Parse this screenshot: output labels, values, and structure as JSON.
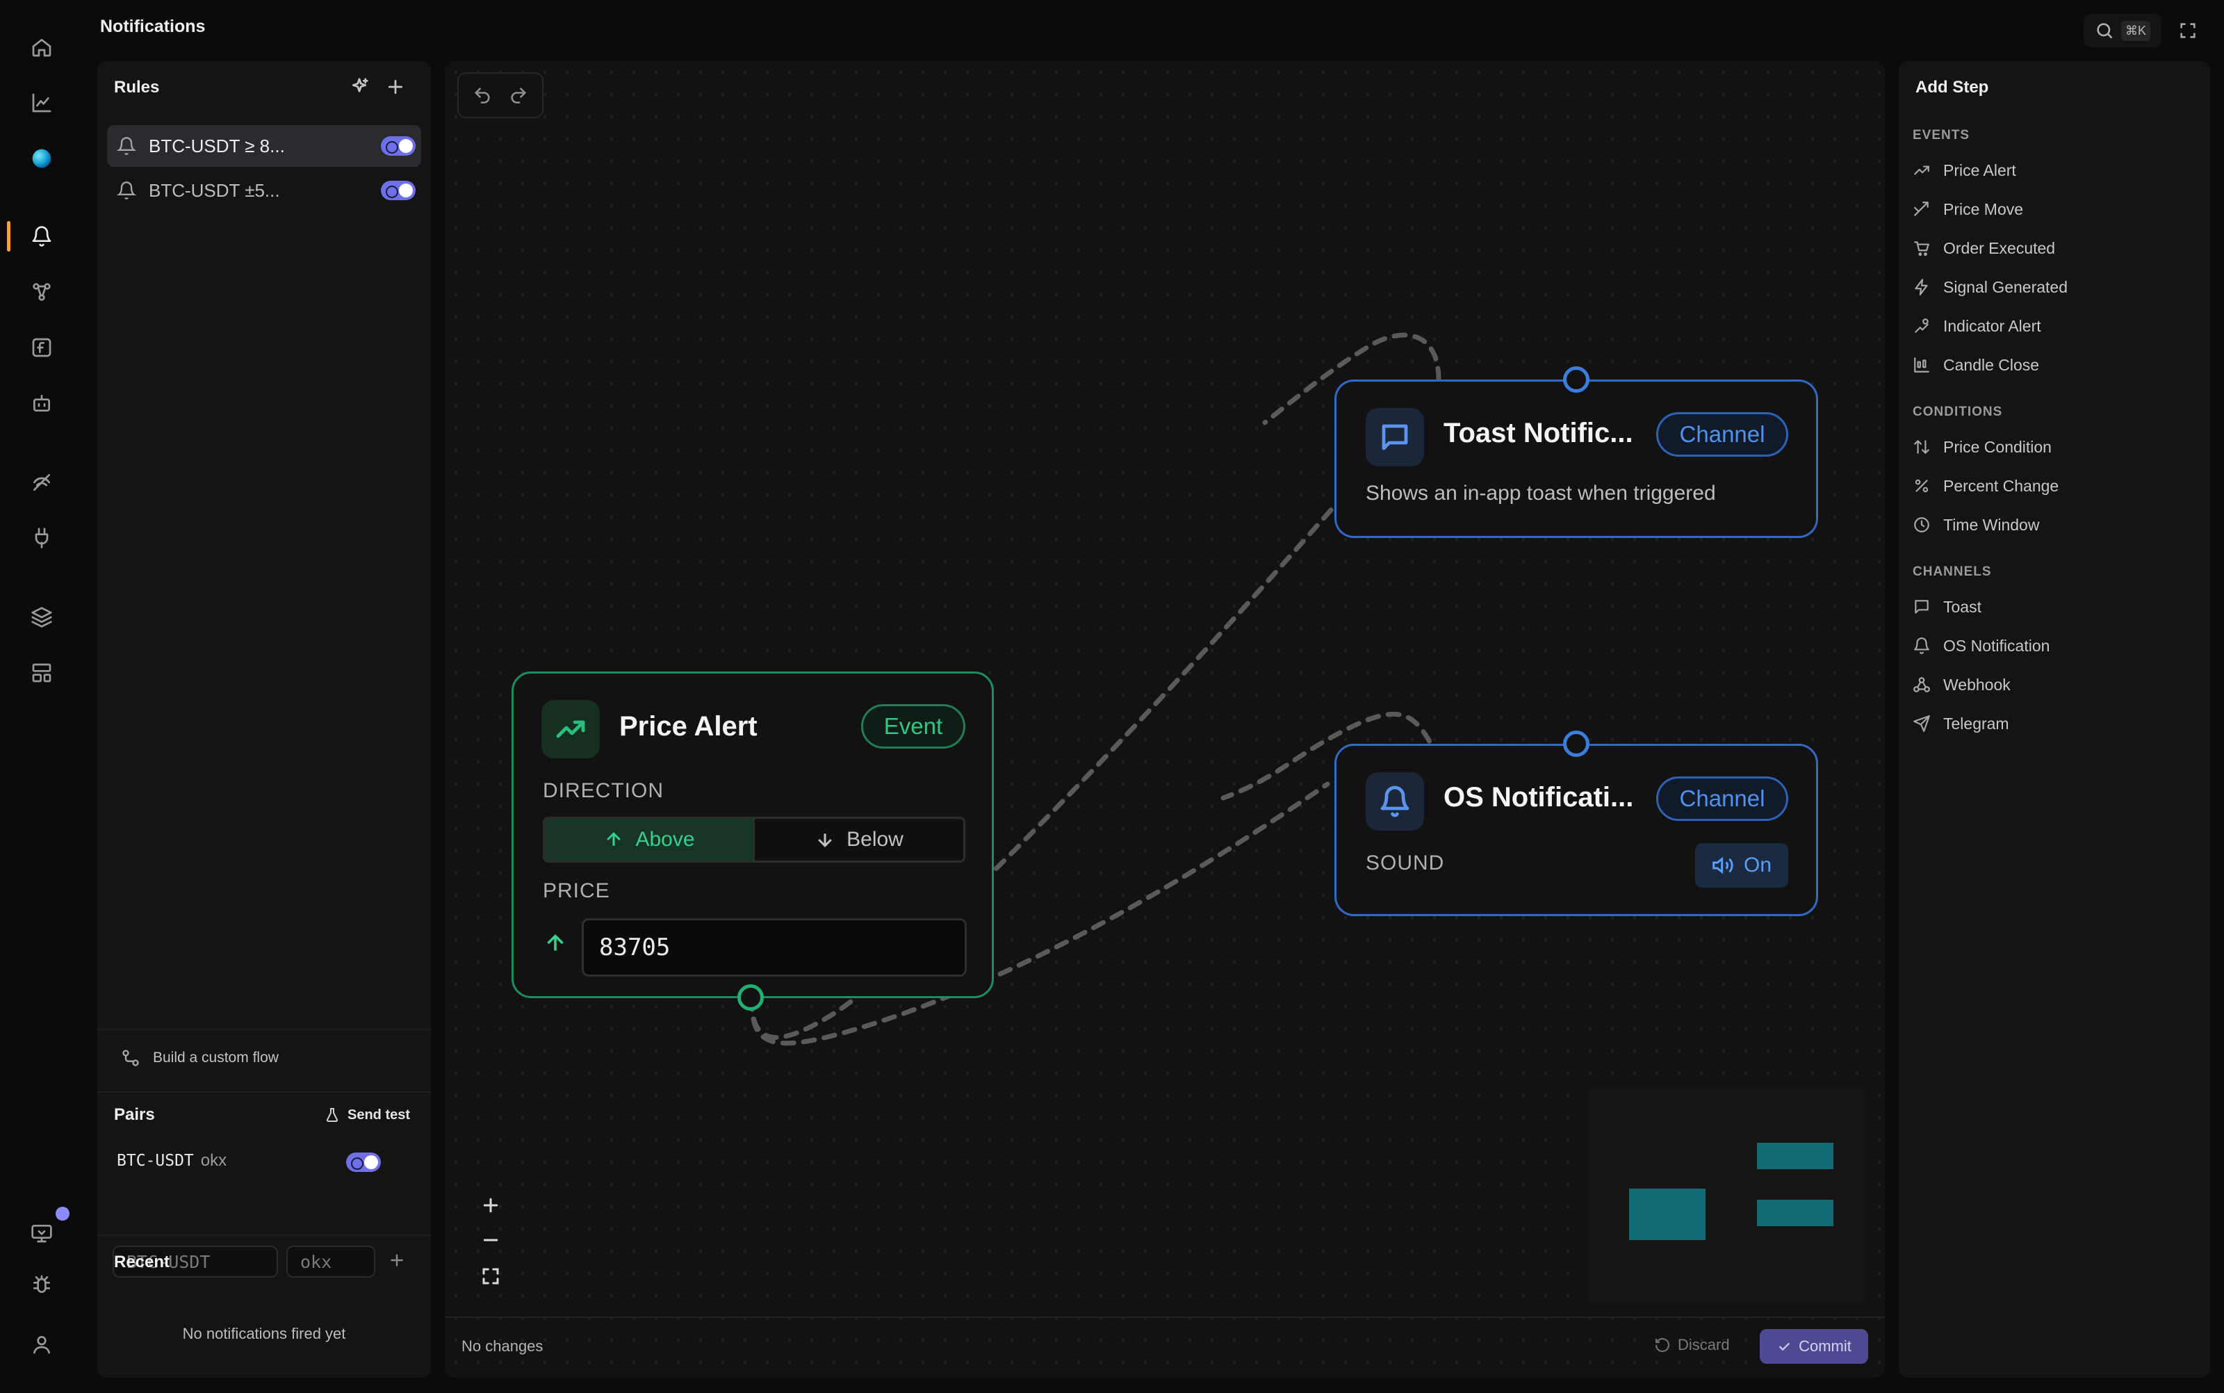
{
  "app": {
    "title": "Notifications",
    "shortcut": "⌘K"
  },
  "rules": {
    "title": "Rules",
    "items": [
      {
        "label": "BTC-USDT ≥ 8...",
        "enabled": true
      },
      {
        "label": "BTC-USDT ±5...",
        "enabled": true
      }
    ],
    "custom_flow": "Build a custom flow"
  },
  "pairs": {
    "title": "Pairs",
    "send_test": "Send test",
    "items": [
      {
        "symbol": "BTC-USDT",
        "exchange": "okx",
        "enabled": true
      }
    ],
    "new_symbol_placeholder": "BTC-USDT",
    "new_exchange_placeholder": "okx"
  },
  "recent": {
    "title": "Recent",
    "empty": "No notifications fired yet"
  },
  "canvas": {
    "status": "No changes",
    "discard": "Discard",
    "commit": "Commit",
    "nodes": {
      "price_alert": {
        "title": "Price Alert",
        "badge": "Event",
        "direction_label": "DIRECTION",
        "direction_options": [
          "Above",
          "Below"
        ],
        "direction_selected": "Above",
        "price_label": "PRICE",
        "price_value": "83705"
      },
      "toast": {
        "title": "Toast Notific...",
        "badge": "Channel",
        "description": "Shows an in-app toast when triggered"
      },
      "os": {
        "title": "OS Notificati...",
        "badge": "Channel",
        "sound_label": "SOUND",
        "sound_value": "On"
      }
    }
  },
  "add_step": {
    "title": "Add Step",
    "events_label": "EVENTS",
    "events": [
      {
        "label": "Price Alert",
        "icon": "trending-up-icon"
      },
      {
        "label": "Price Move",
        "icon": "move-icon"
      },
      {
        "label": "Order Executed",
        "icon": "cart-icon"
      },
      {
        "label": "Signal Generated",
        "icon": "zap-icon"
      },
      {
        "label": "Indicator Alert",
        "icon": "indicator-icon"
      },
      {
        "label": "Candle Close",
        "icon": "candle-icon"
      }
    ],
    "conditions_label": "CONDITIONS",
    "conditions": [
      {
        "label": "Price Condition",
        "icon": "arrows-updown-icon"
      },
      {
        "label": "Percent Change",
        "icon": "percent-icon"
      },
      {
        "label": "Time Window",
        "icon": "clock-icon"
      }
    ],
    "channels_label": "CHANNELS",
    "channels": [
      {
        "label": "Toast",
        "icon": "message-icon"
      },
      {
        "label": "OS Notification",
        "icon": "bell-icon"
      },
      {
        "label": "Webhook",
        "icon": "webhook-icon"
      },
      {
        "label": "Telegram",
        "icon": "send-icon"
      }
    ]
  },
  "colors": {
    "accent": "#7070e8",
    "event_green": "#20a06a",
    "channel_blue": "#3a7de0",
    "minimap_teal": "#116b74",
    "rail_active": "#f0a040"
  }
}
